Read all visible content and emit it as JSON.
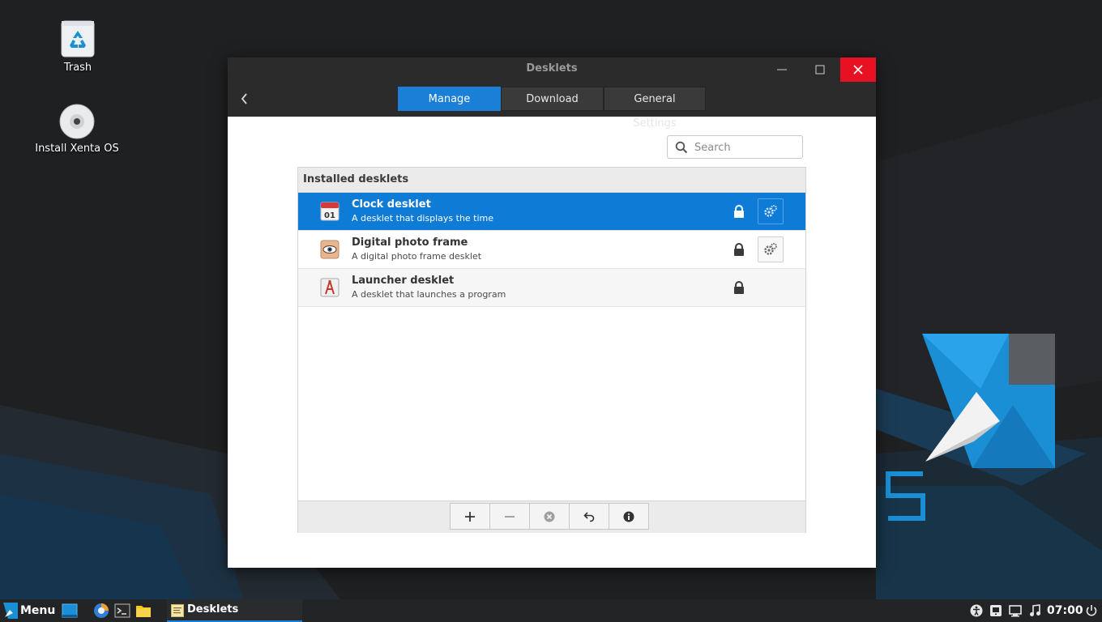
{
  "desktop": {
    "icons": [
      {
        "label": "Trash",
        "icon": "trash-icon"
      },
      {
        "label": "Install Xenta OS",
        "icon": "disc-icon"
      }
    ],
    "wallpaper_accent": "#1a8fd6"
  },
  "window": {
    "title": "Desklets",
    "tabs": [
      {
        "label": "Manage",
        "active": true
      },
      {
        "label": "Download",
        "active": false
      },
      {
        "label": "General Settings",
        "active": false
      }
    ],
    "search": {
      "placeholder": "Search",
      "value": ""
    },
    "list": {
      "header": "Installed desklets",
      "items": [
        {
          "name": "Clock desklet",
          "description": "A desklet that displays the time",
          "icon": "calendar-icon",
          "icon_text": "01",
          "selected": true,
          "locked": true,
          "configurable": true
        },
        {
          "name": "Digital photo frame",
          "description": "A digital photo frame desklet",
          "icon": "photo-eye-icon",
          "selected": false,
          "locked": true,
          "configurable": true
        },
        {
          "name": "Launcher desklet",
          "description": "A desklet that launches a program",
          "icon": "launcher-icon",
          "selected": false,
          "locked": true,
          "configurable": false
        }
      ]
    },
    "toolbar": [
      "add-icon",
      "remove-icon",
      "uninstall-icon",
      "restore-icon",
      "info-icon"
    ]
  },
  "taskbar": {
    "menu_label": "Menu",
    "active_task": "Desklets",
    "clock": "07:00",
    "tray_icons": [
      "accessibility-icon",
      "display-icon",
      "network-icon",
      "sound-icon",
      "power-icon"
    ]
  },
  "colors": {
    "accent": "#1a7fd6",
    "selection": "#0e7bd6",
    "close": "#e81123",
    "titlebar": "#2b2b2b"
  }
}
